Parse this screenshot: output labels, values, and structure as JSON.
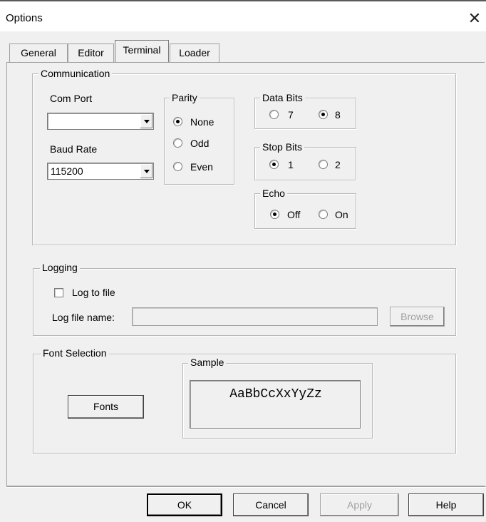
{
  "window": {
    "title": "Options",
    "close_glyph": "✕"
  },
  "tabs": [
    {
      "label": "General"
    },
    {
      "label": "Editor"
    },
    {
      "label": "Terminal",
      "active": true
    },
    {
      "label": "Loader"
    }
  ],
  "communication": {
    "legend": "Communication",
    "com_port": {
      "label": "Com Port",
      "value": ""
    },
    "baud_rate": {
      "label": "Baud Rate",
      "value": "115200"
    },
    "parity": {
      "legend": "Parity",
      "options": [
        "None",
        "Odd",
        "Even"
      ],
      "selected": "None"
    },
    "data_bits": {
      "legend": "Data Bits",
      "options": [
        "7",
        "8"
      ],
      "selected": "8"
    },
    "stop_bits": {
      "legend": "Stop Bits",
      "options": [
        "1",
        "2"
      ],
      "selected": "1"
    },
    "echo": {
      "legend": "Echo",
      "options": [
        "Off",
        "On"
      ],
      "selected": "Off"
    }
  },
  "logging": {
    "legend": "Logging",
    "log_to_file": {
      "label": "Log to file",
      "checked": false
    },
    "log_file_name": {
      "label": "Log file name:",
      "value": ""
    },
    "browse_label": "Browse"
  },
  "font_selection": {
    "legend": "Font Selection",
    "fonts_button": "Fonts",
    "sample_legend": "Sample",
    "sample_text": "AaBbCcXxYyZz"
  },
  "buttons": {
    "ok": "OK",
    "cancel": "Cancel",
    "apply": "Apply",
    "help": "Help"
  }
}
